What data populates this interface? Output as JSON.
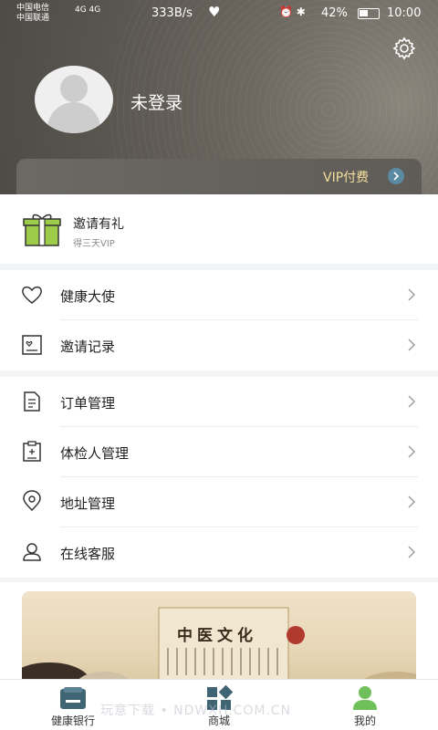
{
  "status_bar": {
    "carrier_1": "中国电信",
    "carrier_2": "中国联通",
    "network": "4G 4G",
    "speed": "333B/s",
    "battery_pct": "42%",
    "time": "10:00"
  },
  "profile": {
    "login_text": "未登录",
    "vip_label": "VIP付费"
  },
  "invite": {
    "title": "邀请有礼",
    "subtitle": "得三天VIP"
  },
  "menu_group_1": [
    {
      "label": "健康大使",
      "icon": "heart-icon"
    },
    {
      "label": "邀请记录",
      "icon": "invite-record-icon"
    }
  ],
  "menu_group_2": [
    {
      "label": "订单管理",
      "icon": "order-icon"
    },
    {
      "label": "体检人管理",
      "icon": "checkup-person-icon"
    },
    {
      "label": "地址管理",
      "icon": "location-icon"
    },
    {
      "label": "在线客服",
      "icon": "customer-service-icon"
    }
  ],
  "banner": {
    "title": "中医文化"
  },
  "tabbar": [
    {
      "label": "健康银行",
      "icon": "wallet-icon",
      "active": false
    },
    {
      "label": "商城",
      "icon": "shop-icon",
      "active": false
    },
    {
      "label": "我的",
      "icon": "profile-icon",
      "active": true
    }
  ],
  "watermark": "玩意下载 • NDWXH.COM.CN",
  "colors": {
    "header_bg": "#5a5650",
    "vip_text": "#f4df9b",
    "active_tab": "#6fbf5a",
    "tab_icon": "#3f6474",
    "gift_green": "#9dcb4a"
  }
}
